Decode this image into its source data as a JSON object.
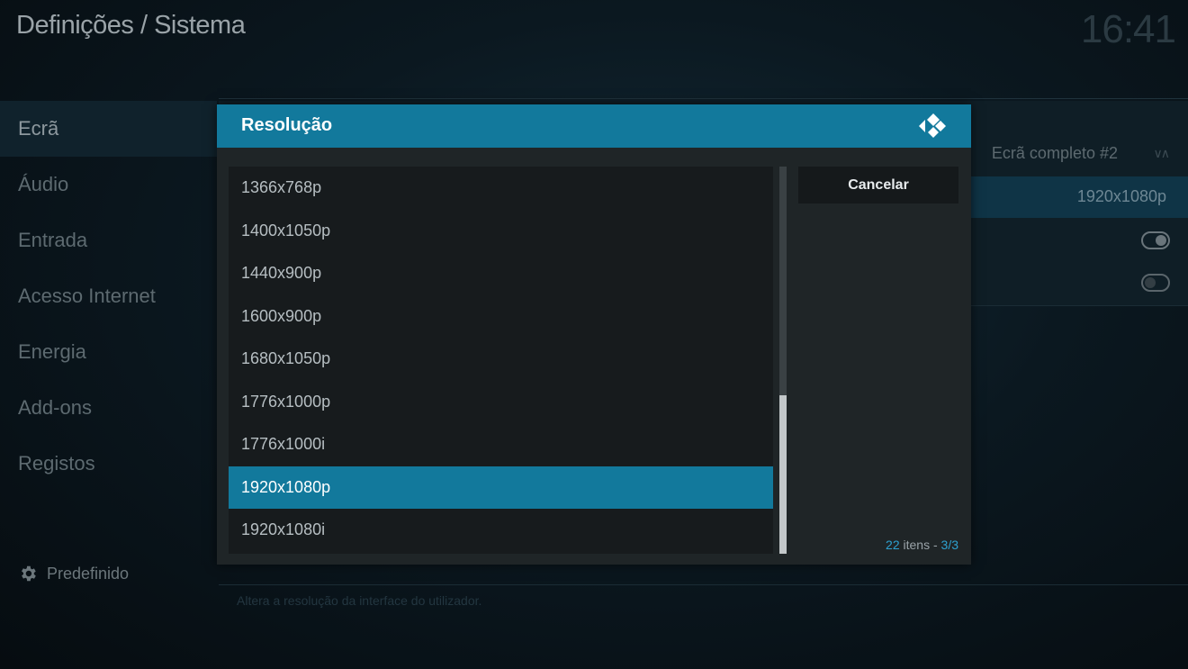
{
  "header": {
    "title": "Definições / Sistema",
    "clock": "16:41"
  },
  "sidebar": {
    "items": [
      {
        "label": "Ecrã",
        "active": true
      },
      {
        "label": "Áudio"
      },
      {
        "label": "Entrada"
      },
      {
        "label": "Acesso Internet"
      },
      {
        "label": "Energia"
      },
      {
        "label": "Add-ons"
      },
      {
        "label": "Registos"
      }
    ],
    "preset_label": "Predefinido"
  },
  "background_settings": {
    "monitor_value": "Ecrã completo #2",
    "resolution_value": "1920x1080p",
    "help_text": "Altera a resolução da interface do utilizador."
  },
  "dialog": {
    "title": "Resolução",
    "items": [
      "1366x768p",
      "1400x1050p",
      "1440x900p",
      "1600x900p",
      "1680x1050p",
      "1776x1000p",
      "1776x1000i",
      "1920x1080p",
      "1920x1080i"
    ],
    "selected_index": 7,
    "cancel_label": "Cancelar",
    "count": {
      "total": "22",
      "label": " itens - ",
      "page": "3/3"
    }
  },
  "colors": {
    "accent": "#12799c",
    "highlight": "#2da0cf"
  }
}
